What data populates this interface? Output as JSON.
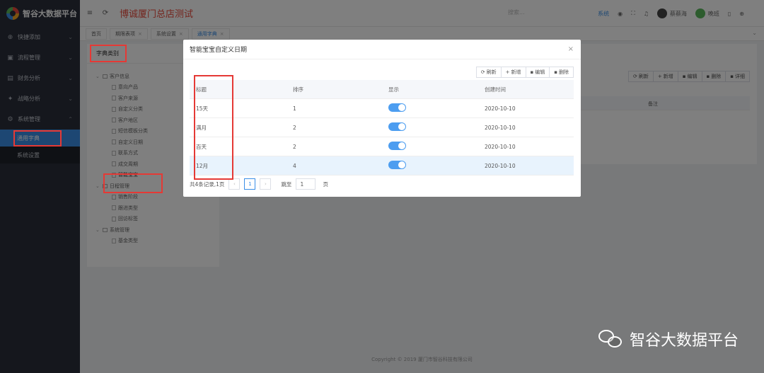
{
  "app": {
    "logo_text": "智谷大数据平台",
    "page_title": "博诚厦门总店测试"
  },
  "sidebar": {
    "items": [
      {
        "icon": "plus-circle-icon",
        "glyph": "⊕",
        "label": "快捷添加",
        "arrow": "⌄"
      },
      {
        "icon": "briefcase-icon",
        "glyph": "▣",
        "label": "流程管理",
        "arrow": "⌄"
      },
      {
        "icon": "chart-icon",
        "glyph": "▤",
        "label": "财务分析",
        "arrow": "⌄"
      },
      {
        "icon": "rocket-icon",
        "glyph": "✦",
        "label": "战略分析",
        "arrow": "⌄"
      },
      {
        "icon": "gear-icon",
        "glyph": "⚙",
        "label": "系统管理",
        "arrow": "⌃"
      }
    ],
    "submenu": [
      {
        "label": "通用字典",
        "active": true
      },
      {
        "label": "系统设置",
        "active": false
      }
    ]
  },
  "topbar": {
    "menu_icon": "≡",
    "refresh_icon": "⟳",
    "search_placeholder": "搜索...",
    "link": "系统",
    "user1": "蔡蔡海",
    "user2": "晚班"
  },
  "tabs": [
    {
      "label": "首页",
      "closable": false,
      "active": false
    },
    {
      "label": "期限表项",
      "closable": true,
      "active": false
    },
    {
      "label": "系统设置",
      "closable": true,
      "active": false
    },
    {
      "label": "通用字典",
      "closable": true,
      "active": true
    }
  ],
  "left_panel": {
    "title": "字典类别",
    "tree": [
      {
        "label": "客户信息",
        "type": "parent"
      },
      {
        "label": "意向产品",
        "type": "child"
      },
      {
        "label": "客户来源",
        "type": "child"
      },
      {
        "label": "自定义分类",
        "type": "child"
      },
      {
        "label": "客户地区",
        "type": "child"
      },
      {
        "label": "短信模板分类",
        "type": "child"
      },
      {
        "label": "自定义日期",
        "type": "child"
      },
      {
        "label": "联系方式",
        "type": "child"
      },
      {
        "label": "成交周期",
        "type": "child"
      },
      {
        "label": "智能宝宝",
        "type": "child",
        "highlight": true
      },
      {
        "label": "日程管理",
        "type": "parent"
      },
      {
        "label": "销售阶段",
        "type": "child"
      },
      {
        "label": "跟进类型",
        "type": "child"
      },
      {
        "label": "回访标签",
        "type": "child"
      },
      {
        "label": "系统管理",
        "type": "parent"
      },
      {
        "label": "基金类型",
        "type": "child"
      }
    ]
  },
  "right_panel": {
    "toolbar": [
      {
        "glyph": "⟳",
        "label": "刷新"
      },
      {
        "glyph": "+",
        "label": "新增"
      },
      {
        "glyph": "▪",
        "label": "编辑"
      },
      {
        "glyph": "▪",
        "label": "删除"
      },
      {
        "glyph": "▪",
        "label": "详细"
      }
    ],
    "col_note": "备注"
  },
  "footer": "Copyright © 2019 厦门市智谷科技有限公司",
  "modal": {
    "title": "智能宝宝自定义日期",
    "close": "×",
    "toolbar": [
      {
        "glyph": "⟳",
        "label": "刷新"
      },
      {
        "glyph": "+",
        "label": "新增"
      },
      {
        "glyph": "▪",
        "label": "编辑"
      },
      {
        "glyph": "▪",
        "label": "删除"
      }
    ],
    "columns": [
      "标题",
      "排序",
      "显示",
      "创建时间"
    ],
    "rows": [
      {
        "title": "15天",
        "order": "1",
        "show": true,
        "created": "2020-10-10",
        "selected": false
      },
      {
        "title": "满月",
        "order": "2",
        "show": true,
        "created": "2020-10-10",
        "selected": false
      },
      {
        "title": "百天",
        "order": "2",
        "show": true,
        "created": "2020-10-10",
        "selected": false
      },
      {
        "title": "12月",
        "order": "4",
        "show": true,
        "created": "2020-10-10",
        "selected": true
      }
    ],
    "pager": {
      "summary": "共4条记录,1页",
      "prev": "‹",
      "current": "1",
      "next": "›",
      "goto_label": "跳至",
      "goto_value": "1",
      "page_unit": "页"
    }
  },
  "watermark": "智谷大数据平台",
  "colors": {
    "accent": "#3a8ee6",
    "highlight": "#e53935",
    "title_red": "#e84b3c",
    "sidebar": "#2b2f3a"
  }
}
